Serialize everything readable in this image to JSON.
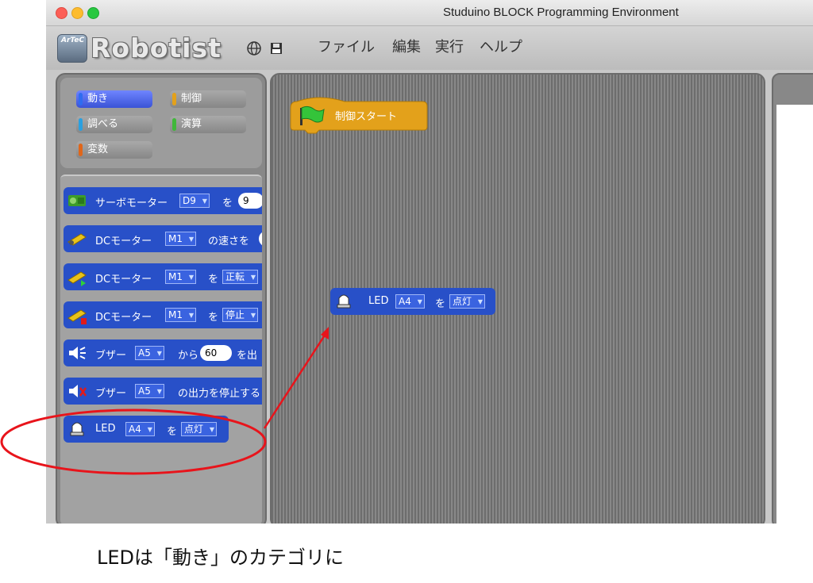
{
  "window": {
    "title": "Studuino BLOCK Programming Environment"
  },
  "toolbar": {
    "logo_badge": "ArTeC",
    "logo_text": "Robotist",
    "menus": [
      "ファイル",
      "編集",
      "実行",
      "ヘルプ"
    ],
    "icons": [
      "globe-icon",
      "save-disk-icon"
    ]
  },
  "categories": [
    {
      "label": "動き",
      "color": "#2f6cf0",
      "active": true
    },
    {
      "label": "制御",
      "color": "#e3a11b",
      "active": false
    },
    {
      "label": "調べる",
      "color": "#2aa0e0",
      "active": false
    },
    {
      "label": "演算",
      "color": "#40b83a",
      "active": false
    },
    {
      "label": "変数",
      "color": "#e0661a",
      "active": false
    }
  ],
  "palette_blocks": [
    {
      "icon": "servo-motor-icon",
      "label": "サーボモーター",
      "port": "D9",
      "suffix": "を",
      "value": "9"
    },
    {
      "icon": "dc-motor-icon",
      "label": "DCモーター",
      "port": "M1",
      "suffix": "の速さを",
      "value": ""
    },
    {
      "icon": "dc-motor-forward-icon",
      "label": "DCモーター",
      "port": "M1",
      "suffix": "を",
      "option": "正転"
    },
    {
      "icon": "dc-motor-stop-icon",
      "label": "DCモーター",
      "port": "M1",
      "suffix": "を",
      "option": "停止"
    },
    {
      "icon": "buzzer-icon",
      "label": "ブザー",
      "port": "A5",
      "suffix": "から",
      "value": "60",
      "tail": "を出"
    },
    {
      "icon": "buzzer-off-icon",
      "label": "ブザー",
      "port": "A5",
      "suffix": "の出力を停止する"
    },
    {
      "icon": "led-icon",
      "label": "LED",
      "port": "A4",
      "suffix": "を",
      "option": "点灯"
    }
  ],
  "script": {
    "hat_block": {
      "label": "制御スタート"
    },
    "led_block": {
      "label": "LED",
      "port": "A4",
      "suffix": "を",
      "option": "点灯"
    }
  },
  "caption": "LEDは「動き」のカテゴリに",
  "colors": {
    "motion_block": "#2850c8",
    "control_block": "#e3a11b",
    "annotation": "#e8141b"
  }
}
